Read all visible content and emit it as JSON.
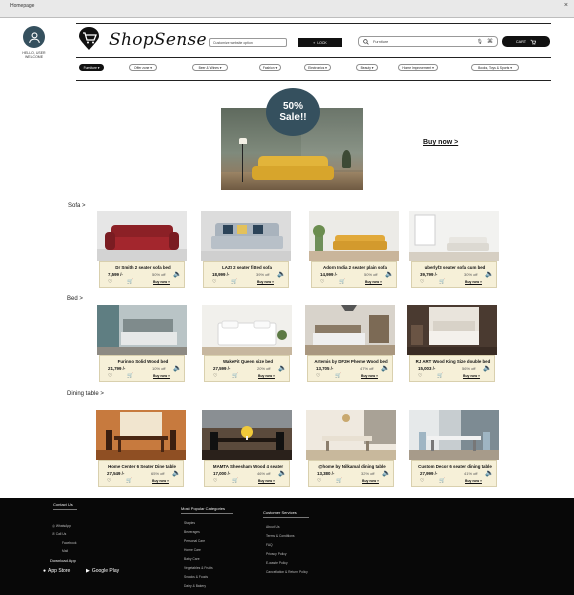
{
  "window": {
    "title": "Homepage",
    "close": "×"
  },
  "account": {
    "greeting": "HELLO, USER WELCOME"
  },
  "header": {
    "logo": "ShopSense",
    "location_placeholder": "Customize website option",
    "location_button": "LOCK",
    "search_placeholder": "Furniture",
    "cart_label": "CART"
  },
  "categories": [
    {
      "label": "Furniture ▾",
      "active": true
    },
    {
      "label": "Offer zone ▾",
      "active": false
    },
    {
      "label": "Beer & Wines ▾",
      "active": false
    },
    {
      "label": "Fashion ▾",
      "active": false
    },
    {
      "label": "Electronics ▾",
      "active": false
    },
    {
      "label": "Beauty ▾",
      "active": false
    },
    {
      "label": "Home Improvement ▾",
      "active": false
    },
    {
      "label": "Books, Toys & Sports ▾",
      "active": false
    }
  ],
  "hero": {
    "badge_line1": "50%",
    "badge_line2": "Sale!!",
    "buy_now": "Buy now >"
  },
  "sections": [
    {
      "title": "Sofa >",
      "products": [
        {
          "name": "Dr Smith 2 seater sofa bed",
          "price": "7,599 /-",
          "discount": "50% off",
          "buy": "Buy now »",
          "image": "red-leather-sofa"
        },
        {
          "name": "LAZI 2 seater fitted sofa",
          "price": "18,999 /-",
          "discount": "39% off",
          "buy": "Buy now »",
          "image": "grey-fabric-sofa"
        },
        {
          "name": "Adorn India 2 seater plain sofa",
          "price": "14,999 /-",
          "discount": "50% off",
          "buy": "Buy now »",
          "image": "yellow-sofa-room"
        },
        {
          "name": "uberlyf3 seater sofa cum bed",
          "price": "39,799 /-",
          "discount": "30% off",
          "buy": "Buy now »",
          "image": "white-sofa-room"
        }
      ]
    },
    {
      "title": "Bed >",
      "products": [
        {
          "name": "Furinno Solid Wood bed",
          "price": "21,799 /-",
          "discount": "10% off",
          "buy": "Buy now »",
          "image": "grey-bed"
        },
        {
          "name": "WakeFit Queen size bed",
          "price": "27,599 /-",
          "discount": "20% off",
          "buy": "Buy now »",
          "image": "white-bed"
        },
        {
          "name": "Artemis by DF2H Pheme Wood bed",
          "price": "13,705 /-",
          "discount": "47% off",
          "buy": "Buy now »",
          "image": "wood-bed"
        },
        {
          "name": "RJ ART Wood King Size double bed",
          "price": "15,003 /-",
          "discount": "56% off",
          "buy": "Buy now »",
          "image": "king-bed"
        }
      ]
    },
    {
      "title": "Dining table >",
      "products": [
        {
          "name": "Home Center 6 Seater Dine table",
          "price": "27,549 /-",
          "discount": "65% off",
          "buy": "Buy now »",
          "image": "wood-dining"
        },
        {
          "name": "MAMTA Sheesham Wood 4 seater",
          "price": "17,000 /-",
          "discount": "46% off",
          "buy": "Buy now »",
          "image": "dark-dining"
        },
        {
          "name": "@home by Nilkamal dining table",
          "price": "13,380 /-",
          "discount": "32% off",
          "buy": "Buy now »",
          "image": "white-dining"
        },
        {
          "name": "Custom Decor 6 seater dining table",
          "price": "27,999 /-",
          "discount": "41% off",
          "buy": "Buy now »",
          "image": "blue-dining"
        }
      ]
    }
  ],
  "footer": {
    "contact_title": "Contact Us",
    "contact_items": [
      "WhatsApp",
      "Call Us",
      "Facebook",
      "Mail"
    ],
    "download_title": "Download App",
    "app_store": "App Store",
    "google_play": "Google Play",
    "popular_title": "Most Popular Categories",
    "popular_items": [
      "Staples",
      "Beverages",
      "Personal Care",
      "Home Care",
      "Baby Care",
      "Vegetables & Fruits",
      "Snacks & Foods",
      "Dairy & Bakery"
    ],
    "service_title": "Customer Services",
    "service_items": [
      "About Us",
      "Terms & Conditions",
      "FAQ",
      "Privacy Policy",
      "E-waste Policy",
      "Cancellation & Return Policy"
    ]
  }
}
